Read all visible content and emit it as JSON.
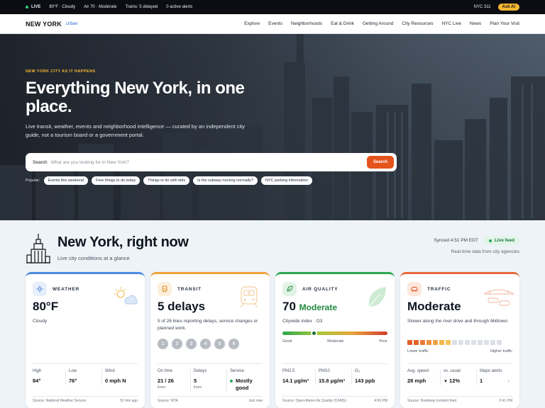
{
  "topbar": {
    "live": "LIVE",
    "weather": "80°F · Cloudy",
    "air": "Air 70 · Moderate",
    "trains": "Trains: 5 delayed",
    "alerts": "0 active alerts",
    "nyc311": "NYC 311",
    "ask_ai": "Ask AI"
  },
  "nav": {
    "logo": "NEW YORK",
    "logo_sub": "Urban",
    "links": [
      "Explore",
      "Events",
      "Neighborhoods",
      "Eat & Drink",
      "Getting Around",
      "City Resources",
      "NYC Live",
      "News",
      "Plan Your Visit"
    ]
  },
  "hero": {
    "eyebrow": "NEW YORK CITY AS IT HAPPENS",
    "title": "Everything New York, in one place.",
    "description": "Live transit, weather, events and neighborhood intelligence — curated by an independent city guide, not a tourism board or a government portal.",
    "search_label": "Search",
    "search_placeholder": "What are you looking for in New York?",
    "search_button": "Search",
    "popular_label": "Popular:",
    "popular": [
      "Events this weekend",
      "Free things to do today",
      "Things to do with kids",
      "Is the subway running normally?",
      "NYC parking information"
    ]
  },
  "section": {
    "title": "New York, right now",
    "subtitle": "Live city conditions at a glance",
    "synced": "Synced 4:51 PM EDT",
    "live_feed": "Live feed",
    "realtime": "Real-time data from city agencies"
  },
  "colors": {
    "accent": "#e5531c",
    "weather": "#4a8be0",
    "transit": "#f0a23a",
    "air": "#2aa64d",
    "traffic": "#e86a3a"
  },
  "cards": {
    "weather": {
      "title": "WEATHER",
      "value": "80°F",
      "desc": "Cloudy",
      "stats": [
        {
          "label": "High",
          "value": "84°"
        },
        {
          "label": "Low",
          "value": "76°"
        },
        {
          "label": "Wind",
          "value": "0 mph N"
        }
      ],
      "source": "Source: National Weather Service",
      "time": "52 min ago"
    },
    "transit": {
      "title": "TRANSIT",
      "value": "5 delays",
      "desc": "5 of 26 lines reporting delays, service changes or planned work.",
      "lines": [
        "1",
        "2",
        "3",
        "4",
        "5",
        "6"
      ],
      "stats": [
        {
          "label": "On time",
          "value": "21 / 26",
          "unit": "lines"
        },
        {
          "label": "Delays",
          "value": "5",
          "unit": "lines"
        },
        {
          "label": "Service",
          "value": "Mostly good"
        }
      ],
      "source": "Source: MTA",
      "time": "Just now"
    },
    "air": {
      "title": "AIR QUALITY",
      "value": "70",
      "level": "Moderate",
      "desc": "Citywide index · O3",
      "scale": [
        "Good",
        "Moderate",
        "Poor"
      ],
      "index_fraction": 0.3,
      "stats": [
        {
          "label": "PM2.5",
          "value": "14.1 μg/m³"
        },
        {
          "label": "PM10",
          "value": "15.8 μg/m³"
        },
        {
          "label": "O₃",
          "value": "143 ppb"
        }
      ],
      "source": "Source: Open-Meteo Air Quality (CAMS)",
      "time": "4:00 PM"
    },
    "traffic": {
      "title": "TRAFFIC",
      "value": "Moderate",
      "desc": "Slower along the river drive and through Midtown",
      "scale": [
        "Lower traffic",
        "Higher traffic"
      ],
      "stats": [
        {
          "label": "Avg. speed",
          "value": "28 mph"
        },
        {
          "label": "vs. usual",
          "value": "12%"
        },
        {
          "label": "Major alerts",
          "value": "1"
        }
      ],
      "source": "Source: Roadway incident feed",
      "time": "2:41 PM"
    }
  }
}
